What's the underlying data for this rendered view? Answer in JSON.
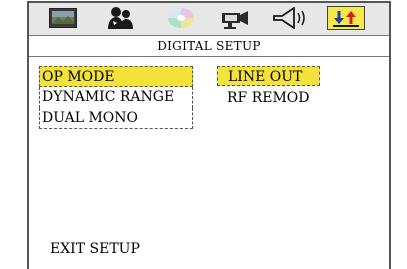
{
  "icon_bar": {
    "icons": [
      {
        "name": "picture-icon"
      },
      {
        "name": "people-icon"
      },
      {
        "name": "disc-icon"
      },
      {
        "name": "projector-icon"
      },
      {
        "name": "speaker-icon"
      },
      {
        "name": "digital-setup-icon",
        "active": true
      }
    ]
  },
  "title": "DIGITAL SETUP",
  "menu": {
    "items": [
      {
        "label": "OP MODE",
        "selected": true
      },
      {
        "label": "DYNAMIC RANGE",
        "selected": false
      },
      {
        "label": "DUAL MONO",
        "selected": false
      }
    ]
  },
  "options": {
    "items": [
      {
        "label": "LINE OUT",
        "selected": true
      },
      {
        "label": "RF REMOD",
        "selected": false
      }
    ]
  },
  "footer": {
    "exit_label": "EXIT SETUP"
  },
  "colors": {
    "highlight": "#f3e23b",
    "iconbar": "#e7e7e7",
    "accent_red": "#d81e1e"
  }
}
